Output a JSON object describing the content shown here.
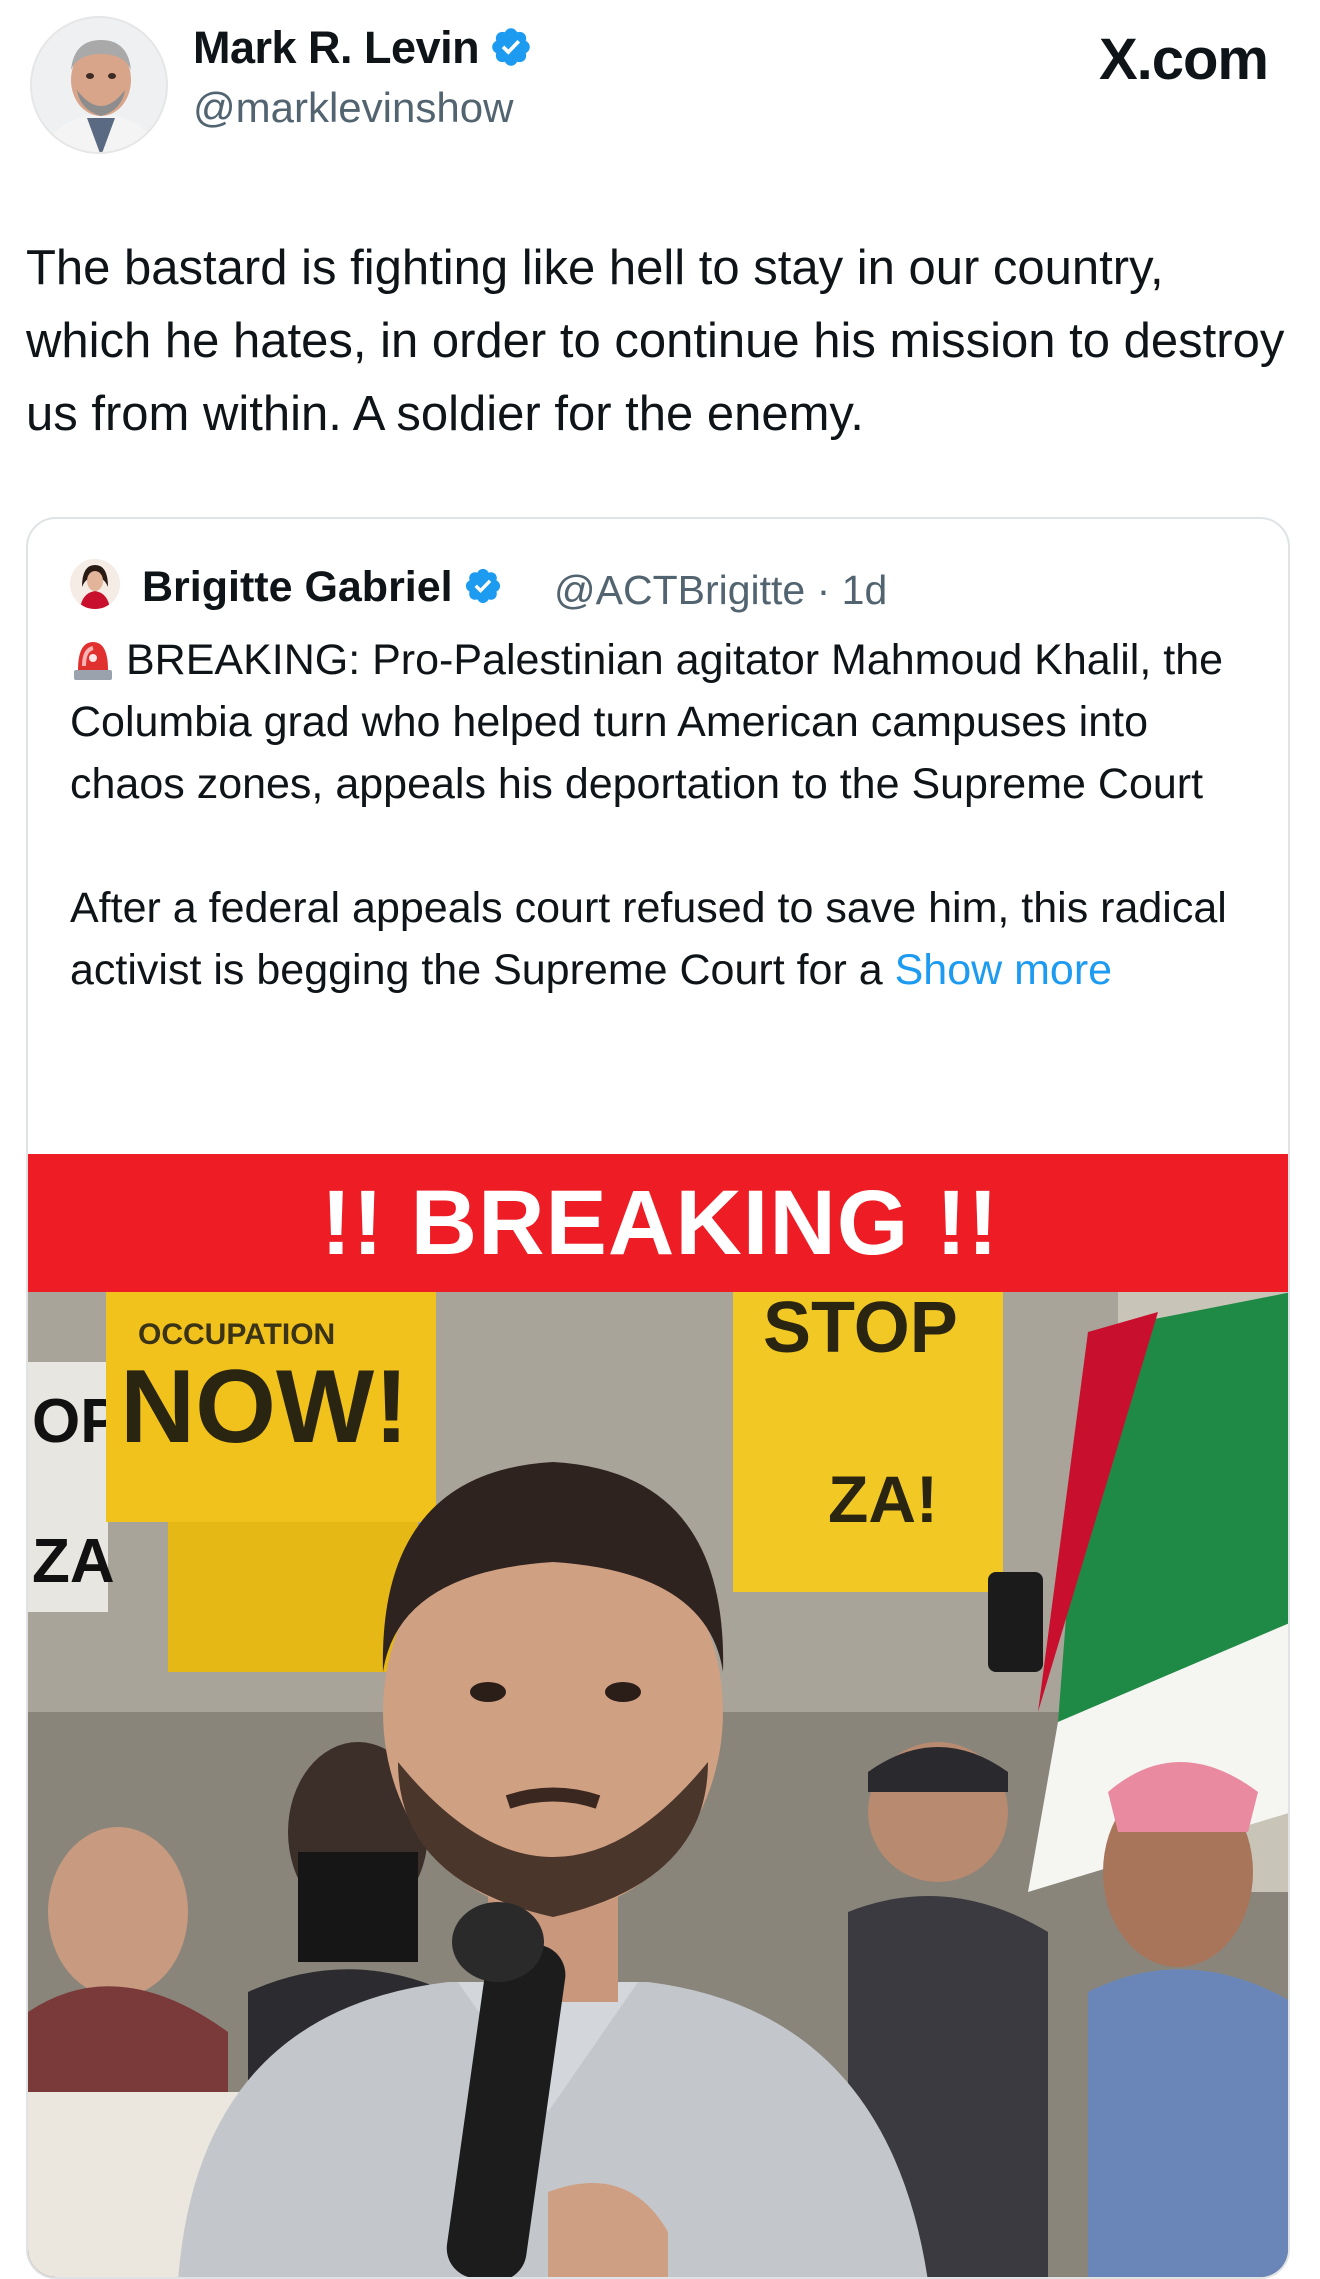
{
  "site": "X.com",
  "author": {
    "name": "Mark R. Levin",
    "handle": "@marklevinshow",
    "verified": true
  },
  "tweet": {
    "text": "The bastard is fighting like hell to stay in our country, which he hates, in order to continue his mission to destroy us from within.  A soldier for the enemy."
  },
  "quoted": {
    "name": "Brigitte Gabriel",
    "handle_time": "@ACTBrigitte · 1d",
    "verified": true,
    "icon": "police-light-emoji",
    "para1": "BREAKING: Pro-Palestinian agitator Mahmoud Khalil, the Columbia grad who helped turn American campuses into chaos zones, appeals his deportation to the Supreme Court",
    "para2": "After a federal appeals court refused to save him, this radical activist is begging the Supreme Court for a",
    "show_more": "Show more"
  },
  "image": {
    "banner": "!! BREAKING !!",
    "banner_color": "#ee1c25",
    "sign_left_big": "NOW!",
    "sign_left_small": "OCCUPATION",
    "sign_right": "STOP",
    "sign_right_2": "ZA!",
    "sign_far_left_1": "OP",
    "sign_far_left_2": "ZA"
  },
  "colors": {
    "link": "#1d9bf0",
    "verified": "#1d9bf0",
    "muted": "#536471",
    "text": "#0f1419"
  }
}
